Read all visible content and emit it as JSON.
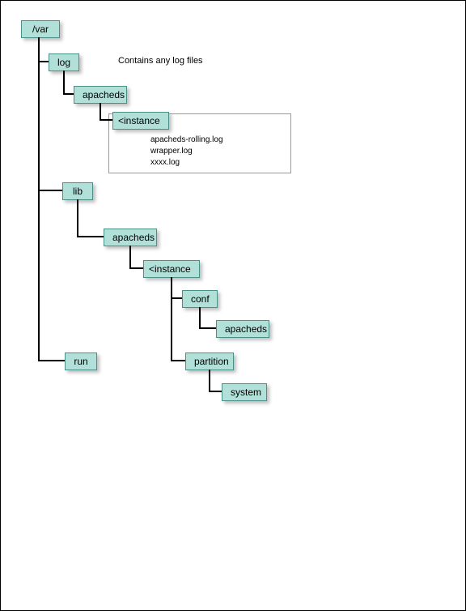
{
  "root": "/var",
  "log_note": "Contains any log files",
  "nodes": {
    "log": "log",
    "log_apacheds": "apacheds",
    "log_instance": "<instance",
    "lib": "lib",
    "lib_apacheds": "apacheds",
    "lib_instance": "<instance",
    "conf": "conf",
    "conf_apacheds": "apacheds",
    "partition": "partition",
    "system": "system",
    "run": "run"
  },
  "log_files": {
    "f1": "apacheds-rolling.log",
    "f2": "wrapper.log",
    "f3": "xxxx.log"
  }
}
